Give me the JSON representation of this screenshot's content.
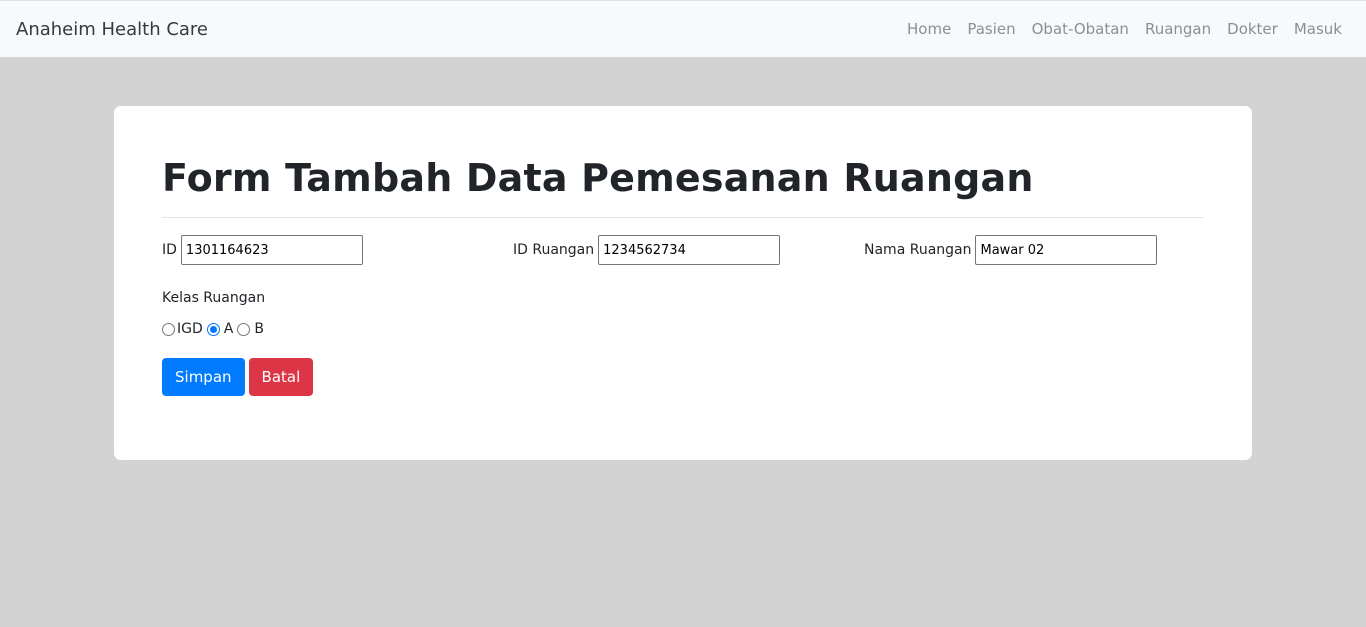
{
  "navbar": {
    "brand": "Anaheim Health Care",
    "links": [
      "Home",
      "Pasien",
      "Obat-Obatan",
      "Ruangan",
      "Dokter",
      "Masuk"
    ]
  },
  "form": {
    "title": "Form Tambah Data Pemesanan Ruangan",
    "id_label": "ID",
    "id_value": "1301164623",
    "room_id_label": "ID Ruangan",
    "room_id_value": "1234562734",
    "room_name_label": "Nama Ruangan",
    "room_name_value": "Mawar 02",
    "class_label": "Kelas Ruangan",
    "class_options": [
      "IGD",
      "A",
      "B"
    ],
    "class_selected": "A",
    "save_label": "Simpan",
    "cancel_label": "Batal"
  },
  "colors": {
    "primary": "#007bff",
    "danger": "#dc3545",
    "background": "#d3d3d3",
    "navbar": "#f8f9fa"
  }
}
